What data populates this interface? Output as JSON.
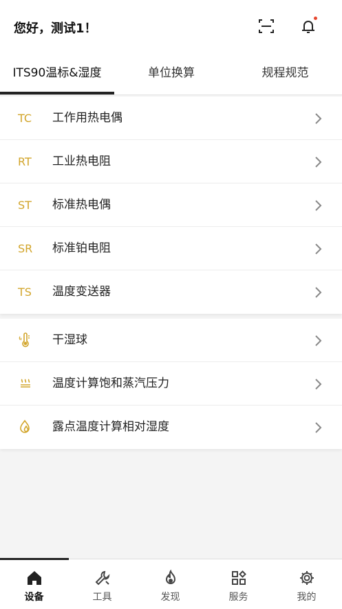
{
  "header": {
    "greeting": "您好，测试1！"
  },
  "tabs": [
    {
      "label": "ITS90温标&湿度"
    },
    {
      "label": "单位换算"
    },
    {
      "label": "规程规范"
    }
  ],
  "temperature_list": [
    {
      "code": "TC",
      "label": "工作用热电偶"
    },
    {
      "code": "RT",
      "label": "工业热电阻"
    },
    {
      "code": "ST",
      "label": "标准热电偶"
    },
    {
      "code": "SR",
      "label": "标准铂电阻"
    },
    {
      "code": "TS",
      "label": "温度变送器"
    }
  ],
  "humidity_list": [
    {
      "icon": "thermometer-icon",
      "label": "干湿球"
    },
    {
      "icon": "steam-icon",
      "label": "温度计算饱和蒸汽压力"
    },
    {
      "icon": "water-drops-icon",
      "label": "露点温度计算相对湿度"
    }
  ],
  "bottom_nav": [
    {
      "icon": "home-icon",
      "label": "设备"
    },
    {
      "icon": "wrench-icon",
      "label": "工具"
    },
    {
      "icon": "flame-icon",
      "label": "发现"
    },
    {
      "icon": "grid-icon",
      "label": "服务"
    },
    {
      "icon": "gear-icon",
      "label": "我的"
    }
  ],
  "colors": {
    "accent": "#d2a52b",
    "notification_dot": "#e6462e"
  }
}
